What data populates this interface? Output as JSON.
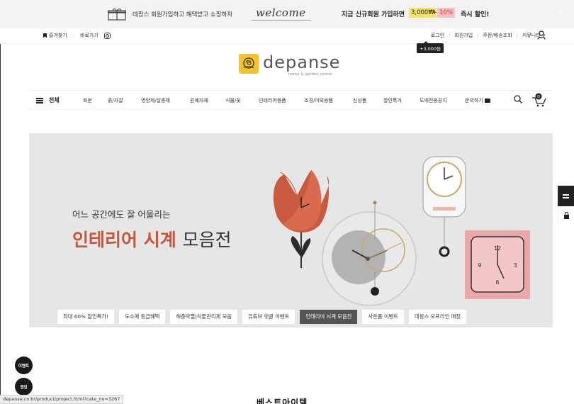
{
  "top_banner": {
    "text1": "데팡스 회원가입하고 혜택받고 쇼핑하자",
    "welcome": "welcome",
    "text2": "지금 신규회원 가입하면",
    "highlight1": "3,000₩",
    "plus": "+",
    "highlight2": "10%",
    "text3": "즉시 할인!",
    "close": "✕",
    "colors": {
      "background": "#f3f3f3",
      "highlight_yellow": "#f7e36b",
      "highlight_pink": "#f6c0c0"
    }
  },
  "util_bar": {
    "bookmark": "즐겨찾기",
    "shortcut": "바로가기",
    "login": "로그인",
    "join": "회원가입",
    "order": "주문/배송조회",
    "community": "커뮤니티 ∨",
    "points_badge": "+3,000원"
  },
  "logo": {
    "name": "depanse",
    "tagline": "home & garden center",
    "color": "#f2c230"
  },
  "nav": {
    "all": "전체",
    "items": [
      "화분",
      "흙/자갈",
      "영양제/살충제",
      "원예자재",
      "식물/꽃",
      "인테리어용품",
      "조경/야외용품",
      "신상품",
      "할인특가",
      "도매전용공지",
      "문의하기"
    ],
    "cart_count": "0"
  },
  "hero": {
    "subtitle": "어느 공간에도 잘 어울리는",
    "title_accent": "인테리어 시계",
    "title_plain": "모음전",
    "accent_color": "#c2573c",
    "tabs": [
      {
        "label": "최대 60% 할인특가!",
        "active": false
      },
      {
        "label": "도소매 등급혜택",
        "active": false
      },
      {
        "label": "해충박멸|식물관리제 모음",
        "active": false
      },
      {
        "label": "유튜브 댓글 이벤트",
        "active": false
      },
      {
        "label": "인테리어 시계 모음전",
        "active": true
      },
      {
        "label": "사은품 이벤트",
        "active": false
      },
      {
        "label": "데팡스 오프라인 매장",
        "active": false
      }
    ]
  },
  "floating": {
    "event": "이벤트",
    "app": "앱업"
  },
  "status_url": "depanse.co.kr/product/project.html?cate_no=3267",
  "section_title": "베스트아이템"
}
